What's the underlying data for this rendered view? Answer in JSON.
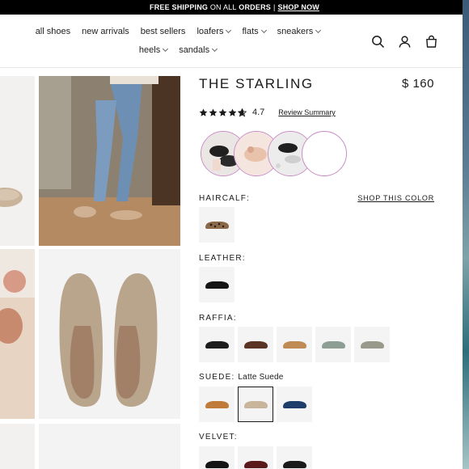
{
  "announcement": {
    "strong1": "FREE SHIPPING",
    "middle": "ON ALL",
    "strong2": "ORDERS",
    "separator": "|",
    "link": "SHOP NOW"
  },
  "nav": {
    "row1": [
      "all shoes",
      "new arrivals",
      "best sellers",
      "loafers",
      "flats",
      "sneakers"
    ],
    "row2": [
      "heels",
      "sandals"
    ]
  },
  "header_icons": [
    "search-icon",
    "account-icon",
    "bag-icon"
  ],
  "product": {
    "title": "THE STARLING",
    "price": "$ 160",
    "rating": "4.7",
    "stars": 4.7,
    "review_link": "Review Summary",
    "shop_color": "SHOP THIS COLOR",
    "sections": {
      "haircalf": "HAIRCALF:",
      "leather": "LEATHER:",
      "raffia": "RAFFIA:",
      "suede": "SUEDE:",
      "suede_selected": "Latte Suede",
      "velvet": "VELVET:"
    }
  },
  "colors": {
    "announcement_bg": "#000000",
    "circle_border": "#c98bc5",
    "raffia": [
      "#1d1d1d",
      "#5a3424",
      "#c08a55",
      "#8d9e95",
      "#9a9a8c"
    ],
    "suede": [
      "#c07a3a",
      "#c8b59a",
      "#1f3d6b"
    ],
    "velvet": [
      "#141414",
      "#5b1a1a",
      "#1a1a1a"
    ]
  }
}
